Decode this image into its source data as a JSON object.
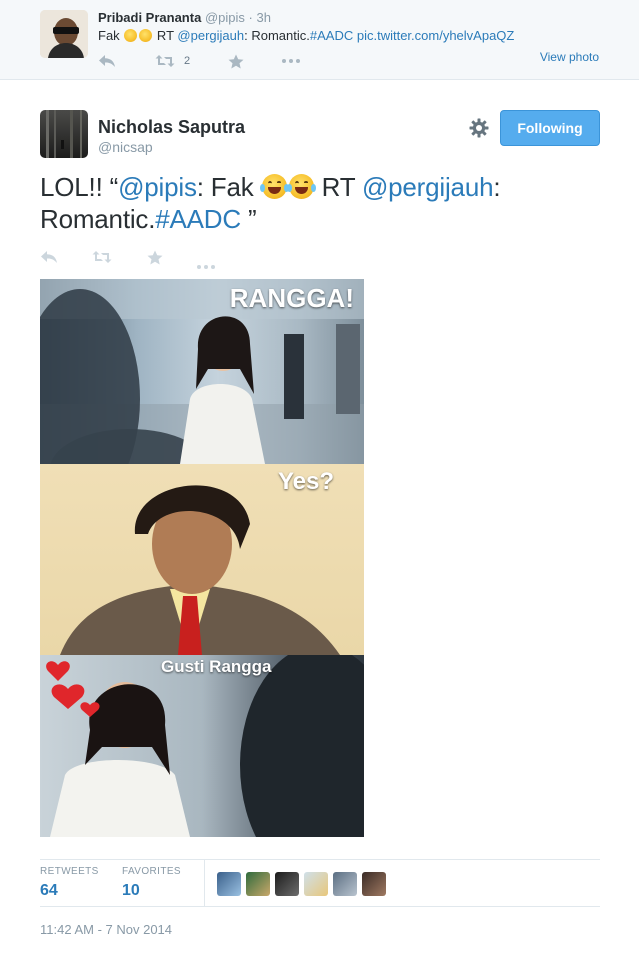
{
  "parent_tweet": {
    "name": "Pribadi Prananta",
    "handle": "@pipis",
    "separator": "·",
    "time": "3h",
    "text_before": "Fak",
    "emoji": "😂😂",
    "text_rt": "RT",
    "mention": "@pergijauh",
    "text_colon": ":",
    "text_word": "Romantic.",
    "hashtag": "#AADC",
    "link": "pic.twitter.com/yhelvApaQZ",
    "retweet_count": "2",
    "view_photo": "View photo"
  },
  "main_tweet": {
    "name": "Nicholas Saputra",
    "handle": "@nicsap",
    "follow_label": "Following",
    "text_start": "LOL!! “",
    "mention1": "@pipis",
    "text_mid": ": Fak",
    "emoji": "😂😂",
    "text_rt": "RT",
    "mention2": "@pergijauh",
    "text_colon": ":",
    "text_word": "Romantic.",
    "hashtag": "#AADC",
    "text_end": " ”"
  },
  "meme": {
    "caption1": "RANGGA!",
    "caption2": "Yes?",
    "caption3": "Gusti Rangga"
  },
  "stats": {
    "retweets_label": "RETWEETS",
    "retweets_value": "64",
    "favorites_label": "FAVORITES",
    "favorites_value": "10"
  },
  "timestamp": "11:42 AM - 7 Nov 2014",
  "icons": [
    "reply-icon",
    "retweet-icon",
    "favorite-icon",
    "more-icon",
    "gear-icon"
  ],
  "colors": {
    "link": "#2b7bb9",
    "follow_button": "#55acee",
    "muted": "#8899a6"
  }
}
